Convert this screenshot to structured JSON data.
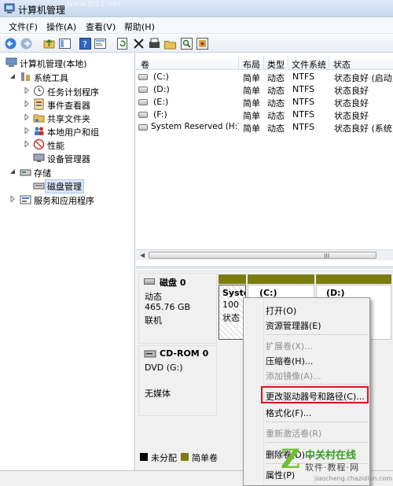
{
  "window": {
    "title": "计算机管理",
    "top_watermark": "www.jb51.net"
  },
  "menu": [
    "文件(F)",
    "操作(A)",
    "查看(V)",
    "帮助(H)"
  ],
  "toolbar": {
    "icons": [
      "back-icon",
      "forward-icon",
      "up-folder-icon",
      "show-tree-icon",
      "help-icon",
      "properties-icon",
      "refresh-icon",
      "delete-icon",
      "disk-props-icon",
      "open-icon",
      "search-icon",
      "wizard-icon"
    ]
  },
  "tree": {
    "root": "计算机管理(本地)",
    "system_tools": "系统工具",
    "task_scheduler": "任务计划程序",
    "event_viewer": "事件查看器",
    "shared_folders": "共享文件夹",
    "local_users": "本地用户和组",
    "performance": "性能",
    "device_manager": "设备管理器",
    "storage": "存储",
    "disk_management": "磁盘管理",
    "services_apps": "服务和应用程序"
  },
  "volumes": {
    "columns": [
      "卷",
      "布局",
      "类型",
      "文件系统",
      "状态"
    ],
    "rows": [
      {
        "volume": "(C:)",
        "layout": "简单",
        "type": "动态",
        "fs": "NTFS",
        "status": "状态良好 (启动,"
      },
      {
        "volume": "(D:)",
        "layout": "简单",
        "type": "动态",
        "fs": "NTFS",
        "status": "状态良好"
      },
      {
        "volume": "(E:)",
        "layout": "简单",
        "type": "动态",
        "fs": "NTFS",
        "status": "状态良好"
      },
      {
        "volume": "(F:)",
        "layout": "简单",
        "type": "动态",
        "fs": "NTFS",
        "status": "状态良好"
      },
      {
        "volume": "System Reserved (H:)",
        "layout": "简单",
        "type": "动态",
        "fs": "NTFS",
        "status": "状态良好 (系统)"
      }
    ],
    "scroll_grip": "III"
  },
  "disks": [
    {
      "name": "磁盘 0",
      "type": "动态",
      "size": "465.76 GB",
      "state": "联机"
    },
    {
      "name": "CD-ROM 0",
      "type": "DVD (G:)",
      "size": "",
      "state": "无媒体"
    }
  ],
  "partitions": [
    {
      "name": "Syste",
      "size": "100",
      "status": "状态"
    },
    {
      "name": "(C:)"
    },
    {
      "name": "(D:)"
    }
  ],
  "legend": [
    {
      "label": "未分配",
      "color": "#000000"
    },
    {
      "label": "简单卷",
      "color": "#7b7b10"
    }
  ],
  "context_menu": {
    "items": [
      {
        "label": "打开(O)",
        "enabled": true
      },
      {
        "label": "资源管理器(E)",
        "enabled": true
      },
      {
        "label": "扩展卷(X)...",
        "enabled": false
      },
      {
        "label": "压缩卷(H)...",
        "enabled": true
      },
      {
        "label": "添加镜像(A)...",
        "enabled": false
      },
      {
        "label": "更改驱动器号和路径(C)...",
        "enabled": true,
        "highlighted": true
      },
      {
        "label": "格式化(F)...",
        "enabled": true
      },
      {
        "label": "重新激活卷(R)",
        "enabled": false
      },
      {
        "label": "删除卷(D)...",
        "enabled": true
      },
      {
        "label": "属性(P)",
        "enabled": true
      }
    ]
  },
  "colors": {
    "accent_highlight": "#d9161c",
    "simple_volume": "#7b7b10",
    "selection": "#dbe8f8"
  },
  "site_watermark": {
    "logo_letter": "Z",
    "name": "中关村在线",
    "tagline": "软件·教程·网",
    "url": "jiaocheng.chazidian.com"
  }
}
